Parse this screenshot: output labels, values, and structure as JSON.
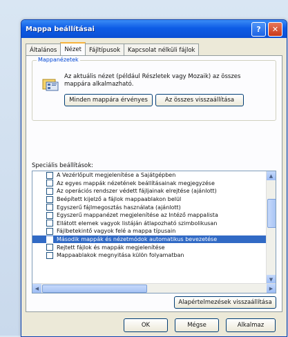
{
  "window": {
    "title": "Mappa beállításai",
    "help": "?",
    "close": "✕"
  },
  "tabs": [
    "Általános",
    "Nézet",
    "Fájltípusok",
    "Kapcsolat nélküli fájlok"
  ],
  "folder_views": {
    "label": "Mappanézetek",
    "description": "Az aktuális nézet (például Részletek vagy Mozaik) az összes mappára alkalmazható.",
    "apply_btn": "Minden mappára érvényes",
    "reset_btn": "Az összes visszaállítása"
  },
  "advanced_label": "Speciális beállítások:",
  "settings": [
    "A Vezérlőpult megjelenítése a Sajátgépben",
    "Az egyes mappák nézetének beállításainak megjegyzése",
    "Az operációs rendszer védett fájljainak elrejtése (ajánlott)",
    "Beépített kijelző a fájlok mappaablakon belül",
    "Egyszerű fájlmegosztás használata (ajánlott)",
    "Egyszerű mappanézet megjelenítése az Intéző mappalista",
    "Ellátott elemek vagyok listáján átlapozható szimbolikusan",
    "Fájlbetekintő vagyok felé a mappa típusain",
    "Második mappák és nézetmódok automatikus bevezetése",
    "Rejtett fájlok és mappák megjelenítése",
    "Mappaablakok megnyitása külön folyamatban"
  ],
  "selected_index": 8,
  "restore_defaults": "Alapértelmezések visszaállítása",
  "footer": {
    "ok": "OK",
    "cancel": "Mégse",
    "apply": "Alkalmaz"
  }
}
